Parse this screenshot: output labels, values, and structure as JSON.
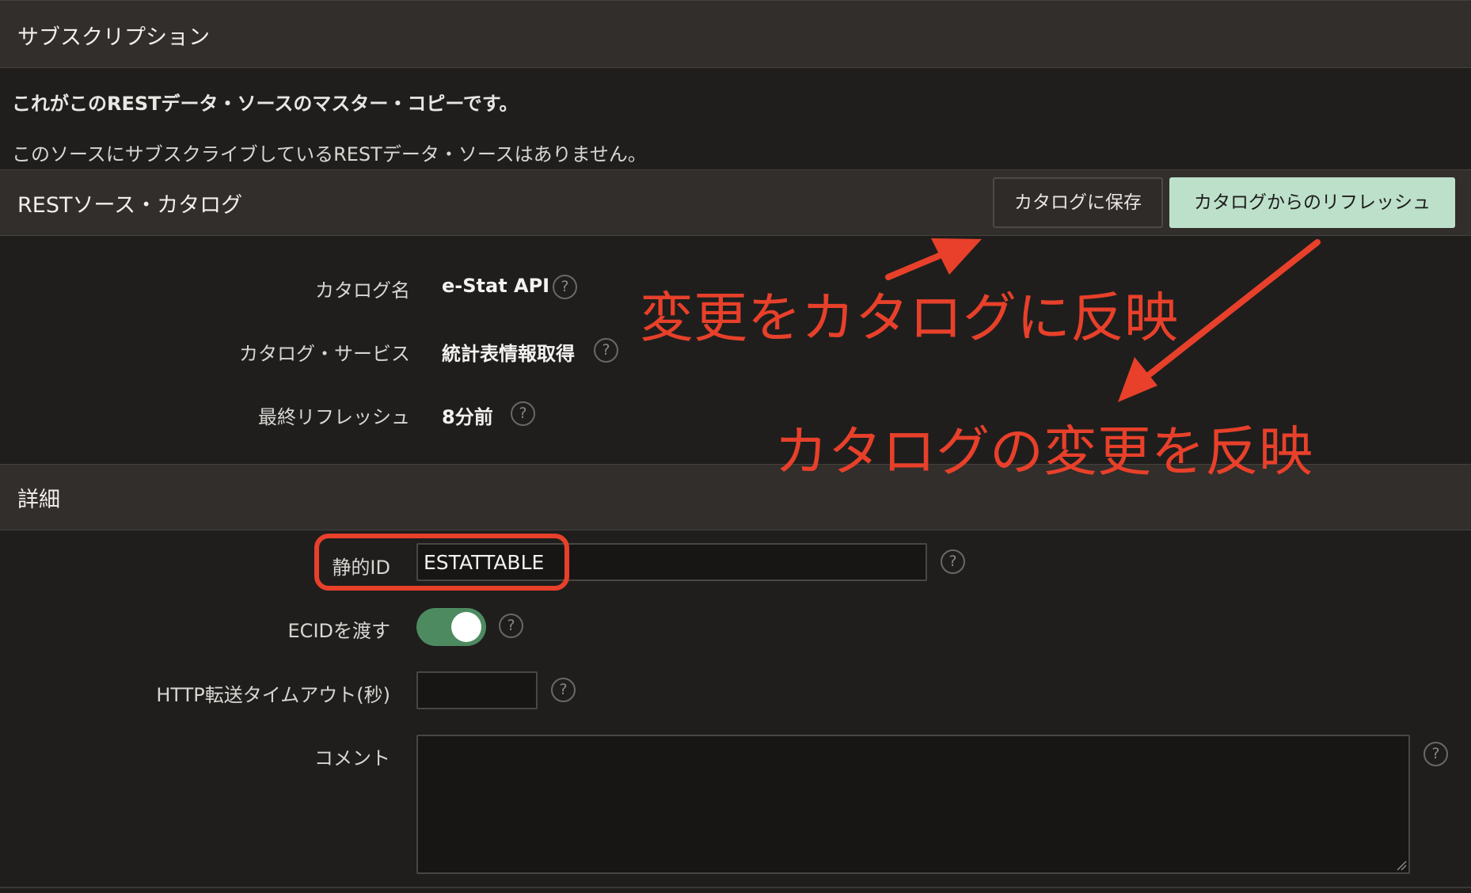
{
  "subscription": {
    "title": "サブスクリプション",
    "master_copy_text": "これがこのRESTデータ・ソースのマスター・コピーです。",
    "no_subscribers_text": "このソースにサブスクライブしているRESTデータ・ソースはありません。"
  },
  "catalog": {
    "title": "RESTソース・カタログ",
    "save_button": "カタログに保存",
    "refresh_button": "カタログからのリフレッシュ",
    "fields": [
      {
        "label": "カタログ名",
        "value": "e-Stat API"
      },
      {
        "label": "カタログ・サービス",
        "value": "統計表情報取得"
      },
      {
        "label": "最終リフレッシュ",
        "value": "8分前"
      }
    ]
  },
  "details": {
    "title": "詳細",
    "static_id_label": "静的ID",
    "static_id_value": "ESTATTABLE",
    "ecid_label": "ECIDを渡す",
    "ecid_enabled": true,
    "timeout_label": "HTTP転送タイムアウト(秒)",
    "timeout_value": "",
    "comment_label": "コメント",
    "comment_value": ""
  },
  "help_symbol": "?",
  "annotations": {
    "save_note": "変更をカタログに反映",
    "refresh_note": "カタログの変更を反映",
    "color": "#e8402a"
  },
  "colors": {
    "background": "#1f1e1d",
    "header": "#312e2b",
    "primary_button": "#bde0cb",
    "toggle_on": "#4e8a60"
  }
}
